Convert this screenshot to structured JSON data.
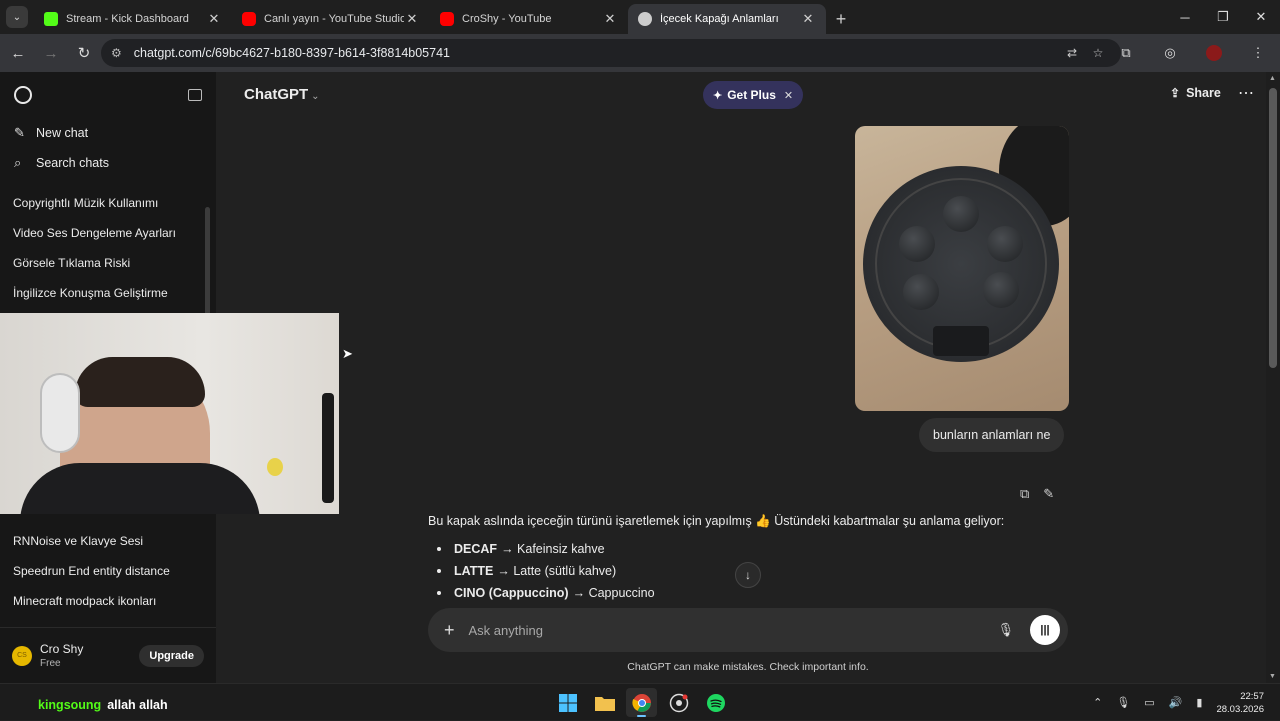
{
  "browser": {
    "tabs": [
      {
        "title": "Stream - Kick Dashboard",
        "favicon": "kick-icon",
        "color": "#53fc18",
        "active": false
      },
      {
        "title": "Canlı yayın - YouTube Studio",
        "favicon": "youtube-icon",
        "color": "#ff0000",
        "active": false
      },
      {
        "title": "CroShy - YouTube",
        "favicon": "youtube-icon",
        "color": "#ff0000",
        "active": false
      },
      {
        "title": "İçecek Kapağı Anlamları",
        "favicon": "chatgpt-icon",
        "color": "#cccccc",
        "active": true
      }
    ],
    "url": "chatgpt.com/c/69bc4627-b180-8397-b614-3f8814b05741"
  },
  "sidebar": {
    "new_chat": "New chat",
    "search_chats": "Search chats",
    "history_top": [
      "Copyrightlı Müzik Kullanımı",
      "Video Ses Dengeleme Ayarları",
      "Görsele Tıklama Riski",
      "İngilizce Konuşma Geliştirme"
    ],
    "history_bottom": [
      "RNNoise ve Klavye Sesi",
      "Speedrun End entity distance",
      "Minecraft modpack ikonları"
    ],
    "user": {
      "initials": "CS",
      "name": "Cro Shy",
      "plan": "Free",
      "upgrade_label": "Upgrade"
    }
  },
  "header": {
    "model": "ChatGPT",
    "get_plus": "Get Plus",
    "share": "Share"
  },
  "conversation": {
    "user_message": "bunların anlamları ne",
    "answer_intro": "Bu kapak aslında içeceğin türünü işaretlemek için yapılmış 👍 Üstündeki kabartmalar şu anlama geliyor:",
    "answer_items": [
      {
        "term": "DECAF",
        "meaning": "→ Kafeinsiz kahve"
      },
      {
        "term": "LATTE",
        "meaning": "→ Latte (sütlü kahve)"
      },
      {
        "term": "CINO (Cappuccino)",
        "meaning": "→ Cappuccino"
      }
    ]
  },
  "composer": {
    "placeholder": "Ask anything",
    "disclaimer": "ChatGPT can make mistakes. Check important info."
  },
  "stream_overlay": {
    "chat_user": "kingsoung",
    "chat_message": "allah allah"
  },
  "taskbar": {
    "time": "22:57",
    "date": "28.03.2026"
  }
}
